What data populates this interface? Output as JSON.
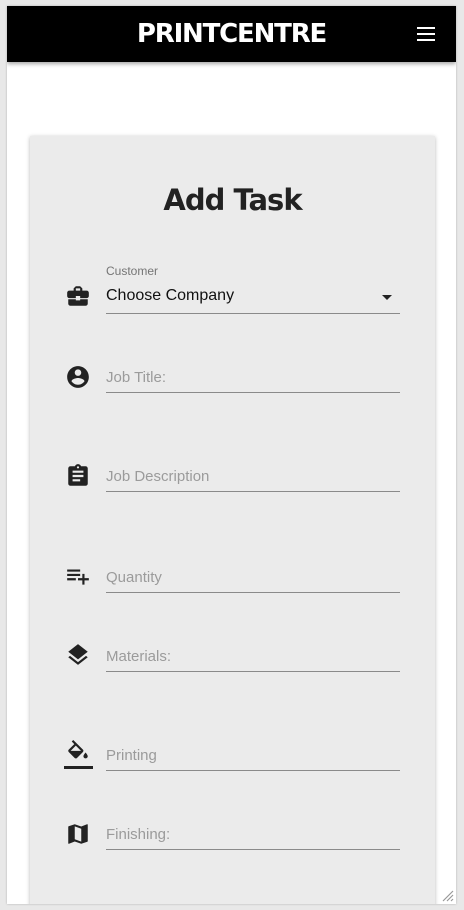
{
  "app": {
    "brand": "PRINTCENTRE"
  },
  "form": {
    "title": "Add Task",
    "customer": {
      "label": "Customer",
      "value": "Choose Company"
    },
    "job_title": {
      "placeholder": "Job Title:"
    },
    "job_description": {
      "placeholder": "Job Description"
    },
    "quantity": {
      "placeholder": "Quantity"
    },
    "materials": {
      "placeholder": "Materials:"
    },
    "printing": {
      "placeholder": "Printing"
    },
    "finishing": {
      "placeholder": "Finishing:"
    }
  },
  "icons": {
    "menu": "hamburger-menu-icon",
    "customer": "briefcase-icon",
    "job_title": "account-circle-icon",
    "job_description": "clipboard-icon",
    "quantity": "playlist-add-icon",
    "materials": "layers-icon",
    "printing": "paint-bucket-icon",
    "finishing": "map-icon"
  },
  "colors": {
    "header": "#000000",
    "card": "#ebebeb",
    "icon": "#222222"
  }
}
